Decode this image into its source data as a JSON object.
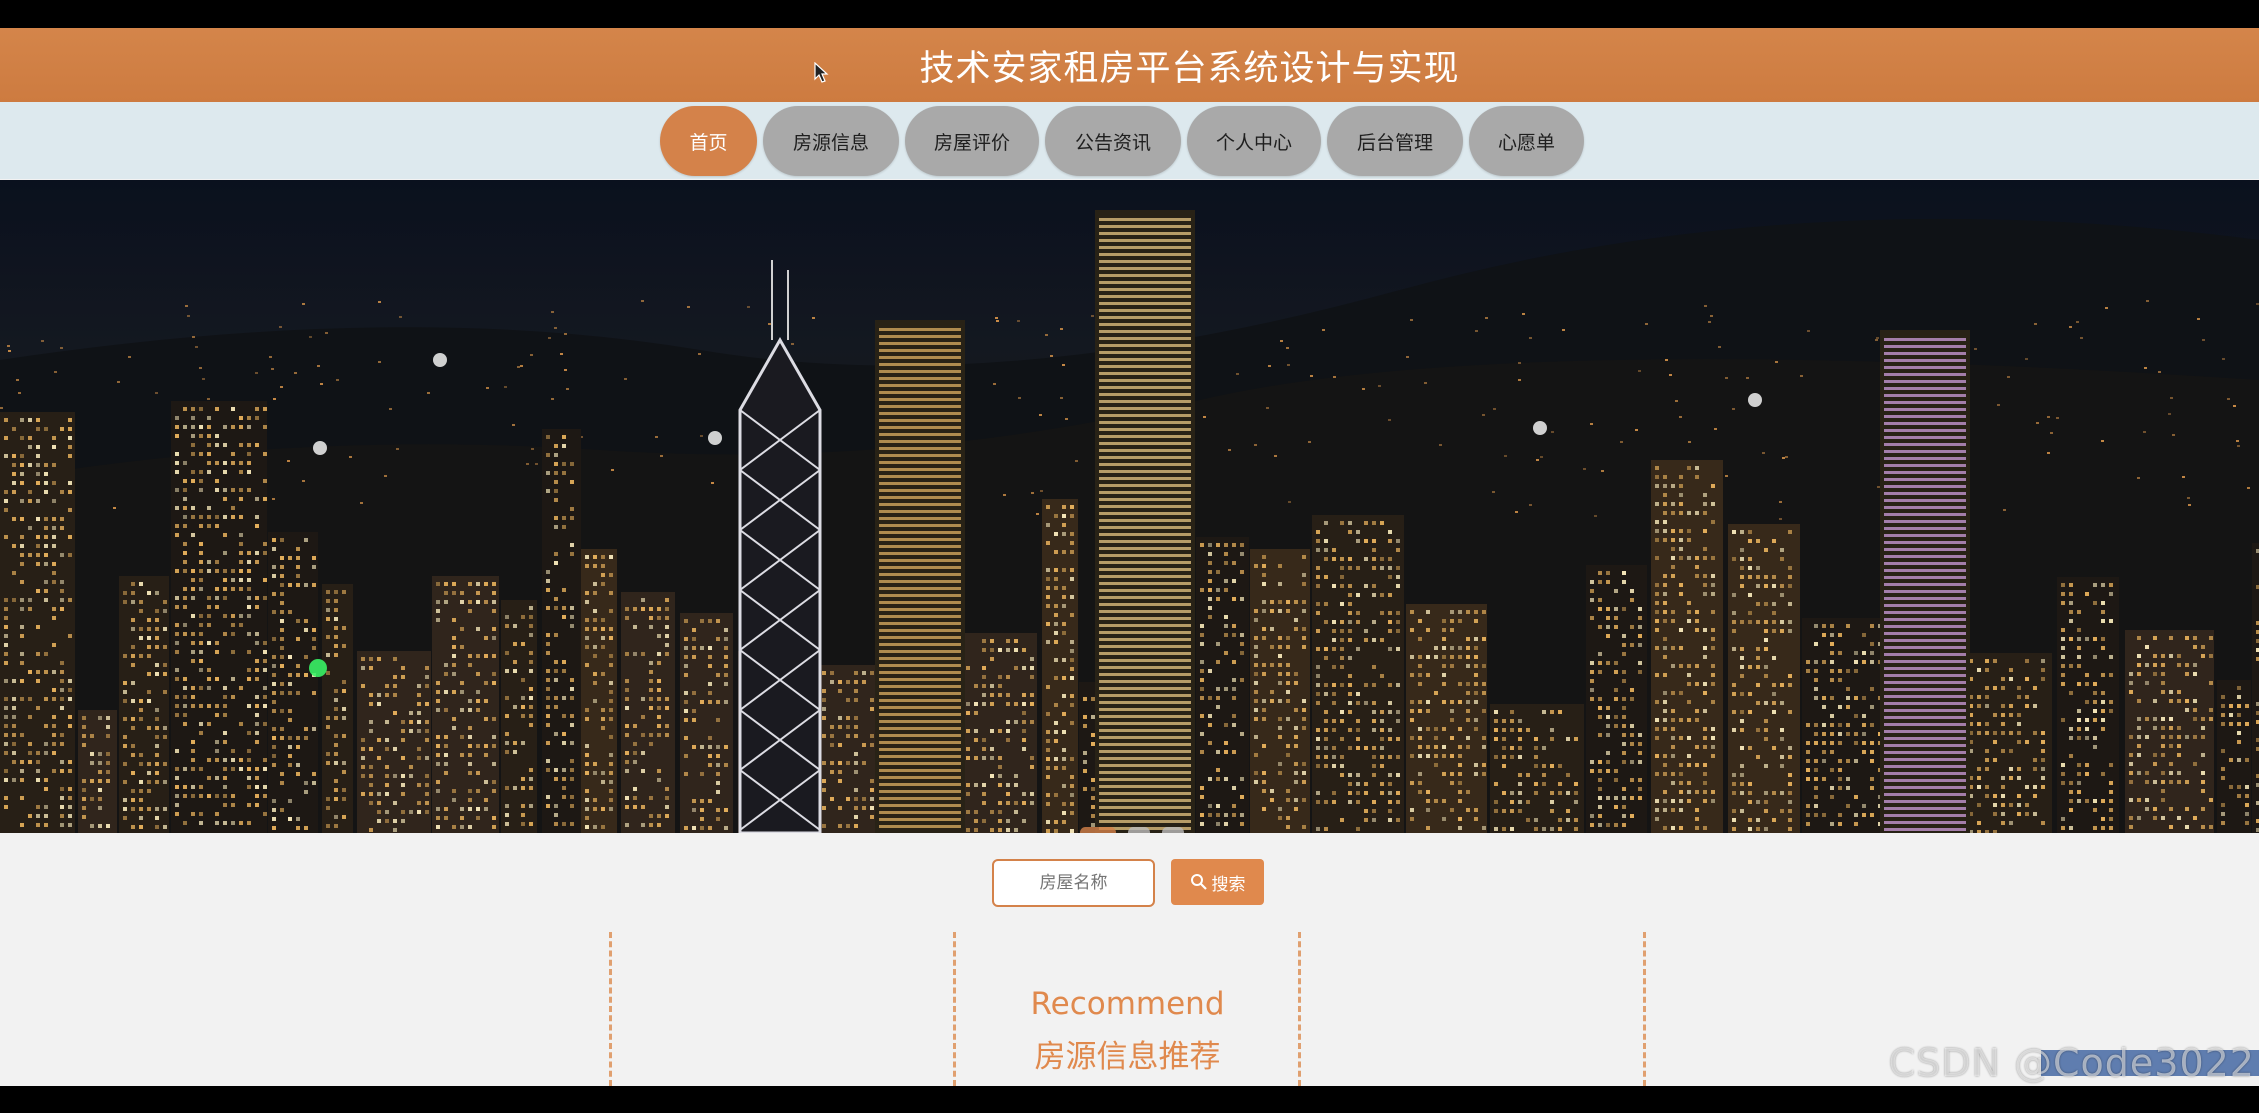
{
  "header": {
    "title": "技术安家租房平台系统设计与实现"
  },
  "nav": {
    "items": [
      {
        "label": "首页",
        "active": true
      },
      {
        "label": "房源信息"
      },
      {
        "label": "房屋评价"
      },
      {
        "label": "公告资讯"
      },
      {
        "label": "个人中心"
      },
      {
        "label": "后台管理"
      },
      {
        "label": "心愿单"
      }
    ]
  },
  "banner": {
    "slides": 3,
    "active_slide": 1
  },
  "search": {
    "placeholder": "房屋名称",
    "button_label": "搜索",
    "icon": "search-icon"
  },
  "recommend": {
    "title_en": "Recommend",
    "title_cn": "房源信息推荐"
  },
  "watermark": "CSDN @Code3022",
  "colors": {
    "accent": "#d4824a",
    "nav_bg": "#dde9ee",
    "nav_item": "#a9a9a9"
  }
}
